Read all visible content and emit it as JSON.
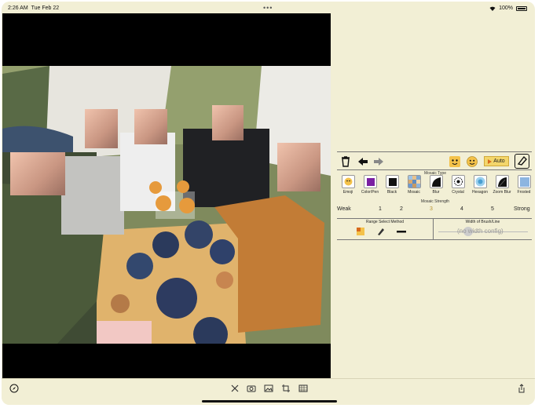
{
  "status_bar": {
    "time": "2:26 AM",
    "date": "Tue Feb 22",
    "dots": "•••",
    "battery": "100%"
  },
  "toolbar": {
    "auto_label": "Auto"
  },
  "mosaic_type": {
    "title": "Mosaic Type",
    "items": [
      {
        "label": "Emoji",
        "icon": "emoji-icon"
      },
      {
        "label": "Color/Pen",
        "icon": "color-pen-icon",
        "color": "#7a1fa2"
      },
      {
        "label": "Black",
        "icon": "black-icon"
      },
      {
        "label": "Mosaic",
        "icon": "mosaic-icon"
      },
      {
        "label": "Blur",
        "icon": "blur-icon"
      },
      {
        "label": "Crystal",
        "icon": "crystal-icon"
      },
      {
        "label": "Hexagon",
        "icon": "hexagon-icon"
      },
      {
        "label": "Zoom Blur",
        "icon": "zoom-blur-icon"
      },
      {
        "label": "Frosted",
        "icon": "frosted-icon"
      }
    ]
  },
  "mosaic_strength": {
    "title": "Mosaic Strength",
    "weak": "Weak",
    "levels": [
      "1",
      "2",
      "3",
      "4",
      "5"
    ],
    "strong": "Strong",
    "selected": "3",
    "selected_color": "#b8922f"
  },
  "range_select": {
    "title": "Range Select Method"
  },
  "brush_width": {
    "title": "Width of Brush/Line",
    "placeholder": "(no width config)"
  },
  "colors": {
    "panel_bg": "#f2efd5",
    "accent": "#f3d66b"
  }
}
